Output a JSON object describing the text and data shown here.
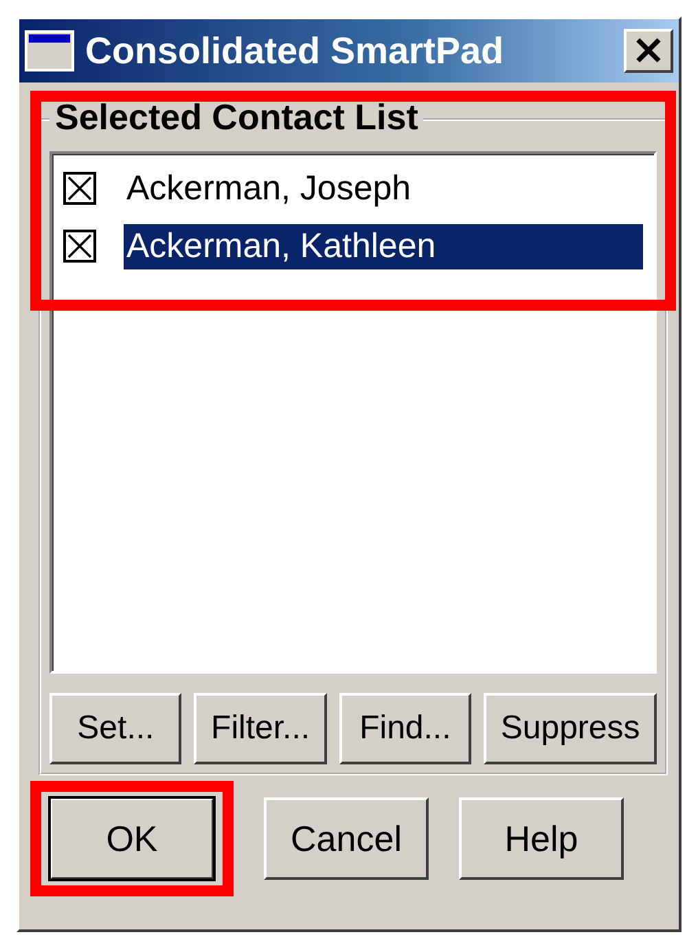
{
  "window": {
    "title": "Consolidated SmartPad",
    "close": "×"
  },
  "group": {
    "title": "Selected Contact List",
    "highlighted": true,
    "items": [
      {
        "label": "Ackerman, Joseph",
        "checked": true,
        "selected": false
      },
      {
        "label": "Ackerman, Kathleen",
        "checked": true,
        "selected": true
      }
    ],
    "buttons": [
      {
        "label": "Set..."
      },
      {
        "label": "Filter..."
      },
      {
        "label": "Find..."
      },
      {
        "label": "Suppress"
      }
    ]
  },
  "buttons": [
    {
      "label": "OK",
      "default": true,
      "highlighted": true
    },
    {
      "label": "Cancel",
      "default": false,
      "highlighted": false
    },
    {
      "label": "Help",
      "default": false,
      "highlighted": false
    }
  ]
}
